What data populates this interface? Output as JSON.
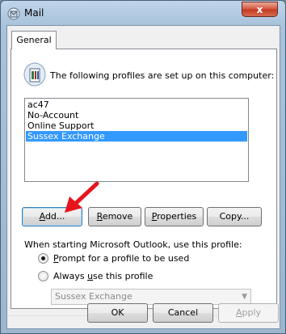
{
  "window": {
    "title": "Mail",
    "close_glyph": "x"
  },
  "tabs": [
    {
      "label": "General"
    }
  ],
  "general": {
    "info_text": "The following profiles are set up on this computer:",
    "profiles": [
      "ac47",
      "No-Account",
      "Online Support",
      "Sussex Exchange"
    ],
    "selected_profile_index": 3,
    "buttons": {
      "add": {
        "mnemonic": "A",
        "rest": "dd..."
      },
      "remove": {
        "mnemonic": "R",
        "rest": "emove"
      },
      "properties": {
        "mnemonic": "P",
        "rest": "roperties"
      },
      "copy": {
        "label": "Copy..."
      }
    },
    "startup_label": "When starting Microsoft Outlook, use this profile:",
    "radio_prompt": {
      "mnemonic": "P",
      "rest": "rompt for a profile to be used",
      "checked": true
    },
    "radio_always": {
      "pre": "Always ",
      "mnemonic": "u",
      "rest": "se this profile",
      "checked": false
    },
    "profile_select": {
      "value": "Sussex Exchange",
      "disabled": true
    }
  },
  "footer": {
    "ok_label": "OK",
    "cancel_label": "Cancel",
    "apply": {
      "mnemonic": "A",
      "rest": "pply",
      "disabled": true
    }
  },
  "annotation": {
    "arrow_color": "#e8141c",
    "points_to": "add-button"
  },
  "colors": {
    "selection": "#3399ff"
  }
}
